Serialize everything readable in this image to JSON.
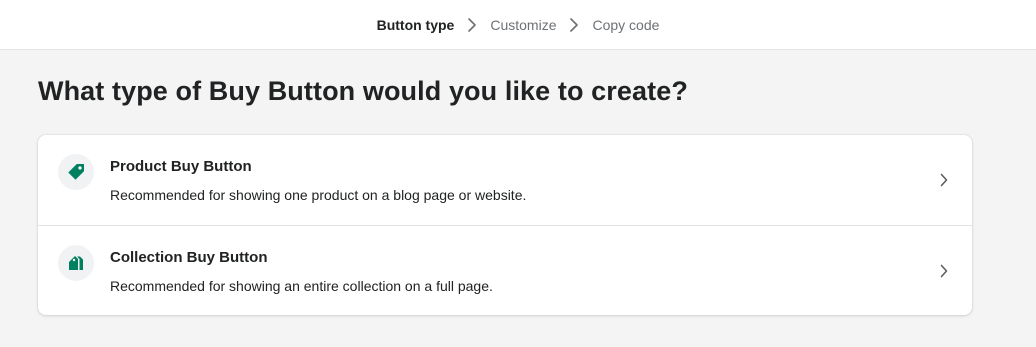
{
  "breadcrumb": {
    "steps": [
      {
        "label": "Button type",
        "active": true
      },
      {
        "label": "Customize",
        "active": false
      },
      {
        "label": "Copy code",
        "active": false
      }
    ]
  },
  "page": {
    "title": "What type of Buy Button would you like to create?"
  },
  "options": [
    {
      "title": "Product Buy Button",
      "description": "Recommended for showing one product on a blog page or website.",
      "icon": "tag-icon"
    },
    {
      "title": "Collection Buy Button",
      "description": "Recommended for showing an entire collection on a full page.",
      "icon": "tags-icon"
    }
  ],
  "colors": {
    "icon_green": "#008060",
    "background": "#f4f4f4",
    "card": "#ffffff",
    "muted_text": "#6d7175",
    "text": "#202223"
  }
}
